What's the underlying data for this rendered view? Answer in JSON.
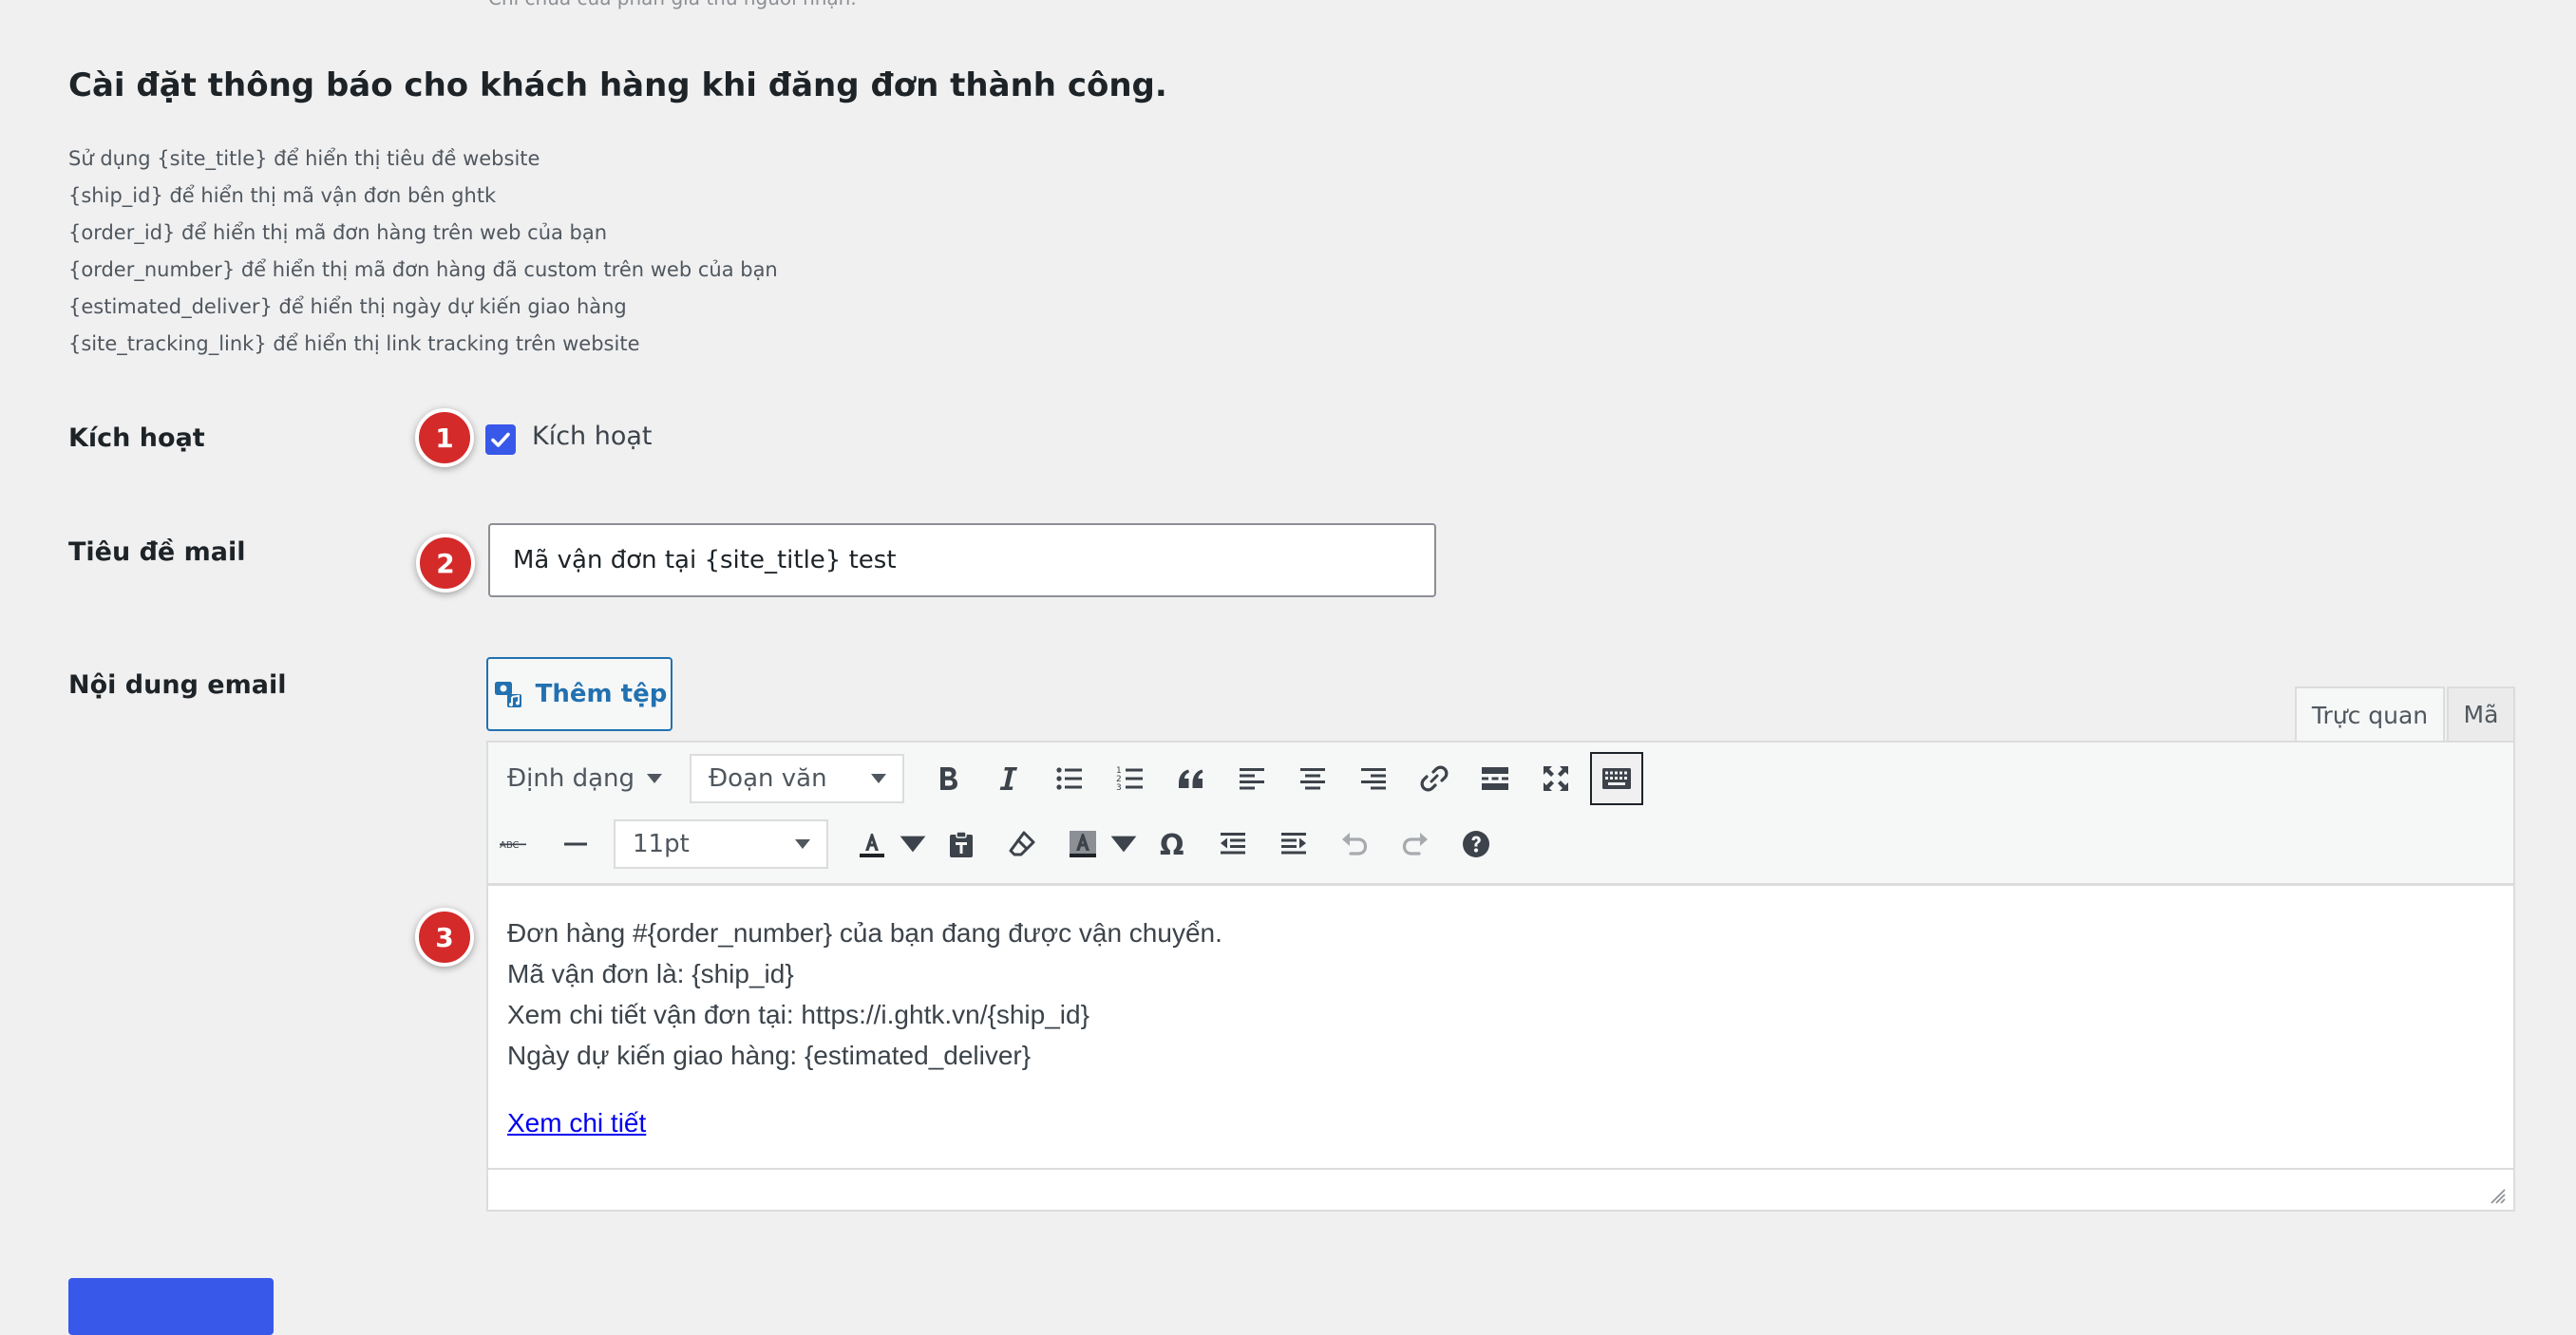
{
  "top_cut_text": "Chỉ chứa của phần giá thư người nhận.",
  "section_title": "Cài đặt thông báo cho khách hàng khi đăng đơn thành công.",
  "help_lines": [
    "Sử dụng {site_title} để hiển thị tiêu đề website",
    "{ship_id} để hiển thị mã vận đơn bên ghtk",
    "{order_id} để hiển thị mã đơn hàng trên web của bạn",
    "{order_number} để hiển thị mã đơn hàng đã custom trên web của bạn",
    "{estimated_deliver} để hiển thị ngày dự kiến giao hàng",
    "{site_tracking_link} để hiển thị link tracking trên website"
  ],
  "activate": {
    "label": "Kích hoạt",
    "checkbox_label": "Kích hoạt",
    "checked": true
  },
  "mail_subject": {
    "label": "Tiêu đề mail",
    "value": "Mã vận đơn tại {site_title} test"
  },
  "email_content": {
    "label": "Nội dung email",
    "add_media_label": "Thêm tệp",
    "tabs": {
      "visual": "Trực quan",
      "code": "Mã"
    },
    "toolbar": {
      "format_menu": "Định dạng",
      "block_format": "Đoạn văn",
      "font_size": "11pt"
    },
    "body_lines": [
      "Đơn hàng #{order_number} của bạn đang được vận chuyển.",
      "Mã vận đơn là: {ship_id}",
      "Xem chi tiết vận đơn tại: https://i.ghtk.vn/{ship_id}",
      "Ngày dự kiến giao hàng: {estimated_deliver}"
    ],
    "link_text": "Xem chi tiết"
  },
  "markers": [
    "1",
    "2",
    "3"
  ],
  "colors": {
    "accent": "#3858e9",
    "marker": "#d42a2a",
    "link": "#2271b1"
  }
}
